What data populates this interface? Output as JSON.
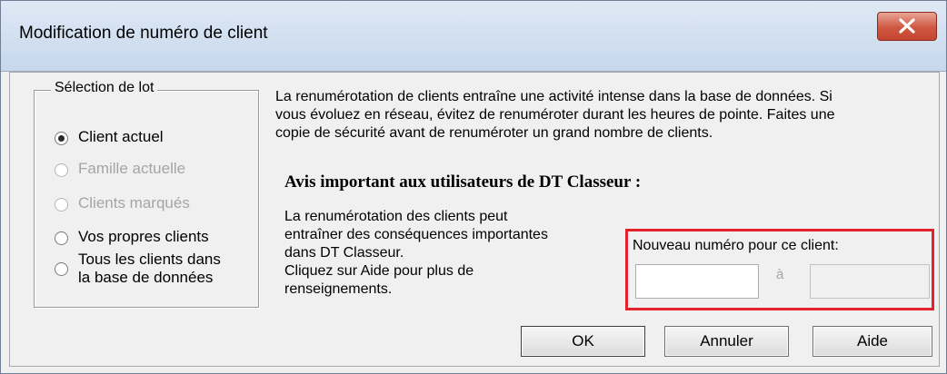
{
  "window": {
    "title": "Modification de numéro de client",
    "close_icon": "close-icon"
  },
  "selection_group": {
    "legend": "Sélection de lot",
    "options": [
      {
        "label": "Client actuel",
        "checked": true,
        "enabled": true
      },
      {
        "label": "Famille actuelle",
        "checked": false,
        "enabled": false
      },
      {
        "label": "Clients marqués",
        "checked": false,
        "enabled": false
      },
      {
        "label": "Vos propres clients",
        "checked": false,
        "enabled": true
      },
      {
        "label_line1": "Tous les clients dans",
        "label_line2": "la base de données",
        "checked": false,
        "enabled": true
      }
    ]
  },
  "description": {
    "line1": "La renumérotation de clients entraîne une activité intense dans la base de données. Si",
    "line2": "vous évoluez en réseau, évitez de renuméroter durant les heures de pointe. Faites une",
    "line3": "copie de sécurité avant de renuméroter un grand nombre de clients."
  },
  "notice": {
    "heading": "Avis important aux utilisateurs de DT Classeur :",
    "line1": "La renumérotation des clients peut",
    "line2": "entraîner des conséquences importantes",
    "line3": "dans DT Classeur.",
    "line4": "Cliquez sur Aide pour plus de",
    "line5": "renseignements."
  },
  "new_number": {
    "label": "Nouveau numéro pour ce client:",
    "from_value": "",
    "separator": "à",
    "to_value": ""
  },
  "buttons": {
    "ok": "OK",
    "cancel": "Annuler",
    "help": "Aide"
  },
  "colors": {
    "highlight_border": "#e4222b",
    "close_button": "#c44531"
  }
}
